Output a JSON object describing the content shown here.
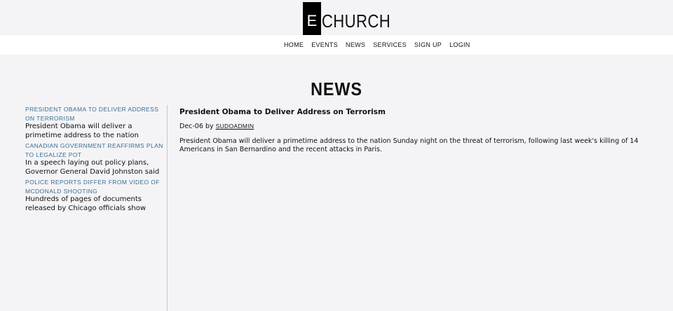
{
  "site": {
    "logo_letter": "E",
    "logo_text": "CHURCH"
  },
  "nav": {
    "items": [
      {
        "label": "HOME"
      },
      {
        "label": "EVENTS"
      },
      {
        "label": "NEWS"
      },
      {
        "label": "SERVICES"
      },
      {
        "label": "SIGN UP"
      },
      {
        "label": "LOGIN"
      }
    ]
  },
  "page": {
    "title": "NEWS"
  },
  "sidebar": {
    "items": [
      {
        "title": "PRESIDENT OBAMA TO DELIVER ADDRESS ON TERRORISM",
        "snippet": "President Obama will deliver a primetime address to the nation Sunday night on"
      },
      {
        "title": "CANADIAN GOVERNMENT REAFFIRMS PLAN TO LEGALIZE POT",
        "snippet": "In a speech laying out policy plans, Governor General David Johnston said"
      },
      {
        "title": "POLICE REPORTS DIFFER FROM VIDEO OF MCDONALD SHOOTING",
        "snippet": "Hundreds of pages of documents released by Chicago officials show police officers"
      }
    ]
  },
  "article": {
    "title": "President Obama to Deliver Address on Terrorism",
    "date": "Dec-06",
    "by": "by",
    "author": "SUDOADMIN",
    "body": "President Obama will deliver a primetime address to the nation Sunday night on the threat of terrorism, following last week's killing of 14 Americans in San Bernardino and the recent attacks in Paris."
  }
}
